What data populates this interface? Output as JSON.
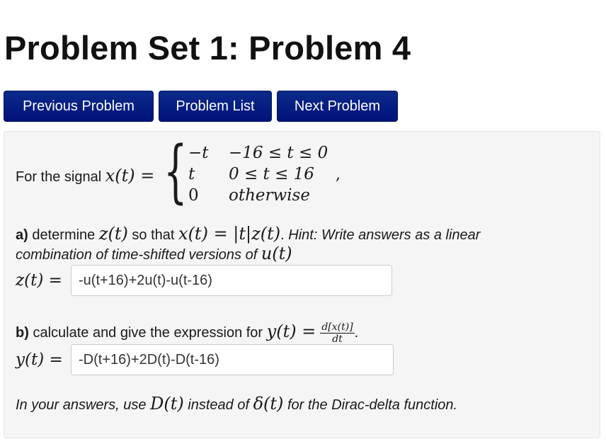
{
  "page": {
    "title": "Problem Set 1: Problem 4"
  },
  "nav": {
    "previous": "Previous Problem",
    "list": "Problem List",
    "next": "Next Problem"
  },
  "problem": {
    "intro_text": "For the signal ",
    "signal_lhs": "x(t) =",
    "cases": [
      {
        "value": "−t",
        "condition": "−16 ≤ t ≤ 0"
      },
      {
        "value": "t",
        "condition": "0 ≤ t ≤ 16"
      },
      {
        "value": "0",
        "condition": "otherwise"
      }
    ],
    "trailing": ",",
    "part_a": {
      "label": "a)",
      "text1": " determine ",
      "math1": "z(t)",
      "text2": " so that ",
      "math2": "x(t) = |t|z(t)",
      "text3": ". ",
      "hint1": "Hint: Write answers as a linear",
      "hint2": "combination of time-shifted versions of ",
      "hint_math": "u(t)",
      "answer_label": "z(t) =",
      "answer_value": "-u(t+16)+2u(t)-u(t-16)"
    },
    "part_b": {
      "label": "b)",
      "text": " calculate and give the expression for ",
      "math": "y(t) =",
      "frac_num": "d[x(t)]",
      "frac_den": "dt",
      "period": ".",
      "answer_label": "y(t) =",
      "answer_value": "-D(t+16)+2D(t)-D(t-16)"
    },
    "note": {
      "text1": "In your answers, use ",
      "math1": "D(t)",
      "text2": " instead of ",
      "math2": "δ(t)",
      "text3": " for the Dirac-delta function."
    }
  }
}
